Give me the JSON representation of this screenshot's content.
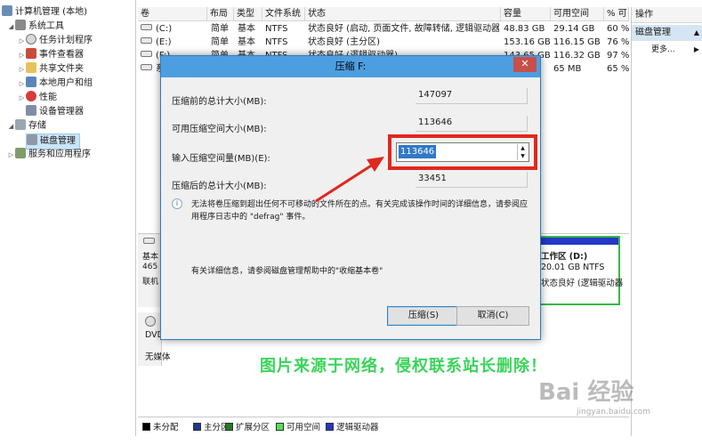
{
  "tree": {
    "items": [
      {
        "label": "计算机管理 (本地)",
        "twisty": ""
      },
      {
        "label": "系统工具",
        "twisty": "◢"
      },
      {
        "label": "任务计划程序",
        "twisty": "▷"
      },
      {
        "label": "事件查看器",
        "twisty": "▷"
      },
      {
        "label": "共享文件夹",
        "twisty": "▷"
      },
      {
        "label": "本地用户和组",
        "twisty": "▷"
      },
      {
        "label": "性能",
        "twisty": "▷"
      },
      {
        "label": "设备管理器",
        "twisty": ""
      },
      {
        "label": "存储",
        "twisty": "◢"
      },
      {
        "label": "磁盘管理",
        "twisty": ""
      },
      {
        "label": "服务和应用程序",
        "twisty": "▷"
      }
    ]
  },
  "volumes": {
    "columns": [
      "卷",
      "布局",
      "类型",
      "文件系统",
      "状态",
      "容量",
      "可用空间",
      "% 可"
    ],
    "rows": [
      {
        "vol": "(C:)",
        "layout": "简单",
        "type": "基本",
        "fs": "NTFS",
        "status": "状态良好 (启动, 页面文件, 故障转储, 逻辑驱动器)",
        "cap": "48.83 GB",
        "free": "29.14 GB",
        "pct": "60 %"
      },
      {
        "vol": "(E:)",
        "layout": "简单",
        "type": "基本",
        "fs": "NTFS",
        "status": "状态良好 (主分区)",
        "cap": "153.16 GB",
        "free": "116.15 GB",
        "pct": "76 %"
      },
      {
        "vol": "(F:)",
        "layout": "简单",
        "type": "基本",
        "fs": "NTFS",
        "status": "状态良好 (逻辑驱动器)",
        "cap": "143.65 GB",
        "free": "116.32 GB",
        "pct": "97 %"
      },
      {
        "vol": "系",
        "layout": "",
        "type": "",
        "fs": "",
        "status": "",
        "cap": "",
        "free": "65 MB",
        "pct": "65 %"
      }
    ]
  },
  "actions": {
    "header": "操作",
    "section": "磁盘管理",
    "more": "更多..."
  },
  "disks": {
    "disk0_lines": [
      "基本",
      "465",
      "联机"
    ],
    "partition_d": {
      "name": "工作区 (D:)",
      "size": "20.01 GB NTFS",
      "status": "状态良好 (逻辑驱动器"
    },
    "cdrom": {
      "name": "DVD (G:)",
      "media": "无媒体"
    }
  },
  "legend": {
    "items": [
      {
        "label": "未分配",
        "color": "#000000"
      },
      {
        "label": "主分区",
        "color": "#1a3a8c"
      },
      {
        "label": "扩展分区",
        "color": "#1e7d1e"
      },
      {
        "label": "可用空间",
        "color": "#52e052"
      },
      {
        "label": "逻辑驱动器",
        "color": "#2438c8"
      }
    ]
  },
  "dialog": {
    "title": "压缩 F:",
    "close": "✕",
    "total_before_label": "压缩前的总计大小(MB):",
    "total_before": "147097",
    "available_label": "可用压缩空间大小(MB):",
    "available": "113646",
    "input_label": "输入压缩空间量(MB)(E):",
    "input_value": "113646",
    "total_after_label": "压缩后的总计大小(MB):",
    "total_after": "33451",
    "info": "无法将卷压缩到超出任何不可移动的文件所在的点。有关完成该操作时间的详细信息，请参阅应用程序日志中的 \"defrag\" 事件。",
    "help": "有关详细信息，请参阅磁盘管理帮助中的\"收缩基本卷\"",
    "shrink_btn": "压缩(S)",
    "cancel_btn": "取消(C)"
  },
  "overlay": {
    "watermark": "图片来源于网络，侵权联系站长删除！",
    "baidu_logo": "Bai 经验",
    "baidu_url": "jingyan.baidu.com",
    "highlight_color": "#e0281e",
    "accent": "#4d9ee0"
  }
}
